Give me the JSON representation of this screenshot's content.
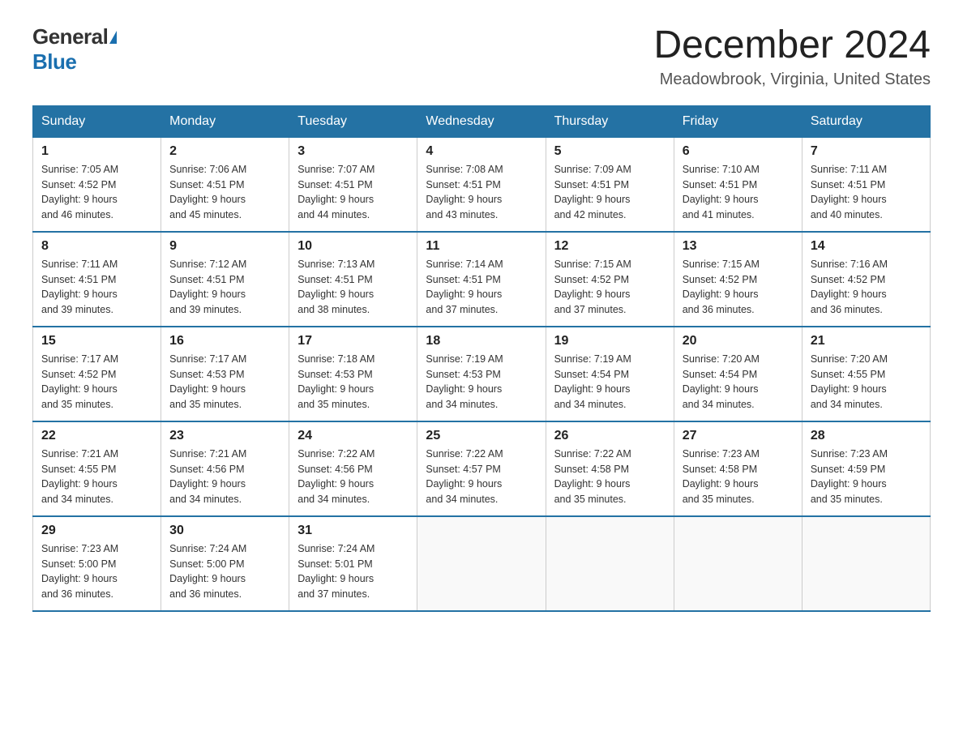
{
  "header": {
    "logo_general": "General",
    "logo_blue": "Blue",
    "title": "December 2024",
    "subtitle": "Meadowbrook, Virginia, United States"
  },
  "days_of_week": [
    "Sunday",
    "Monday",
    "Tuesday",
    "Wednesday",
    "Thursday",
    "Friday",
    "Saturday"
  ],
  "weeks": [
    [
      {
        "day": "1",
        "sunrise": "7:05 AM",
        "sunset": "4:52 PM",
        "daylight": "9 hours and 46 minutes."
      },
      {
        "day": "2",
        "sunrise": "7:06 AM",
        "sunset": "4:51 PM",
        "daylight": "9 hours and 45 minutes."
      },
      {
        "day": "3",
        "sunrise": "7:07 AM",
        "sunset": "4:51 PM",
        "daylight": "9 hours and 44 minutes."
      },
      {
        "day": "4",
        "sunrise": "7:08 AM",
        "sunset": "4:51 PM",
        "daylight": "9 hours and 43 minutes."
      },
      {
        "day": "5",
        "sunrise": "7:09 AM",
        "sunset": "4:51 PM",
        "daylight": "9 hours and 42 minutes."
      },
      {
        "day": "6",
        "sunrise": "7:10 AM",
        "sunset": "4:51 PM",
        "daylight": "9 hours and 41 minutes."
      },
      {
        "day": "7",
        "sunrise": "7:11 AM",
        "sunset": "4:51 PM",
        "daylight": "9 hours and 40 minutes."
      }
    ],
    [
      {
        "day": "8",
        "sunrise": "7:11 AM",
        "sunset": "4:51 PM",
        "daylight": "9 hours and 39 minutes."
      },
      {
        "day": "9",
        "sunrise": "7:12 AM",
        "sunset": "4:51 PM",
        "daylight": "9 hours and 39 minutes."
      },
      {
        "day": "10",
        "sunrise": "7:13 AM",
        "sunset": "4:51 PM",
        "daylight": "9 hours and 38 minutes."
      },
      {
        "day": "11",
        "sunrise": "7:14 AM",
        "sunset": "4:51 PM",
        "daylight": "9 hours and 37 minutes."
      },
      {
        "day": "12",
        "sunrise": "7:15 AM",
        "sunset": "4:52 PM",
        "daylight": "9 hours and 37 minutes."
      },
      {
        "day": "13",
        "sunrise": "7:15 AM",
        "sunset": "4:52 PM",
        "daylight": "9 hours and 36 minutes."
      },
      {
        "day": "14",
        "sunrise": "7:16 AM",
        "sunset": "4:52 PM",
        "daylight": "9 hours and 36 minutes."
      }
    ],
    [
      {
        "day": "15",
        "sunrise": "7:17 AM",
        "sunset": "4:52 PM",
        "daylight": "9 hours and 35 minutes."
      },
      {
        "day": "16",
        "sunrise": "7:17 AM",
        "sunset": "4:53 PM",
        "daylight": "9 hours and 35 minutes."
      },
      {
        "day": "17",
        "sunrise": "7:18 AM",
        "sunset": "4:53 PM",
        "daylight": "9 hours and 35 minutes."
      },
      {
        "day": "18",
        "sunrise": "7:19 AM",
        "sunset": "4:53 PM",
        "daylight": "9 hours and 34 minutes."
      },
      {
        "day": "19",
        "sunrise": "7:19 AM",
        "sunset": "4:54 PM",
        "daylight": "9 hours and 34 minutes."
      },
      {
        "day": "20",
        "sunrise": "7:20 AM",
        "sunset": "4:54 PM",
        "daylight": "9 hours and 34 minutes."
      },
      {
        "day": "21",
        "sunrise": "7:20 AM",
        "sunset": "4:55 PM",
        "daylight": "9 hours and 34 minutes."
      }
    ],
    [
      {
        "day": "22",
        "sunrise": "7:21 AM",
        "sunset": "4:55 PM",
        "daylight": "9 hours and 34 minutes."
      },
      {
        "day": "23",
        "sunrise": "7:21 AM",
        "sunset": "4:56 PM",
        "daylight": "9 hours and 34 minutes."
      },
      {
        "day": "24",
        "sunrise": "7:22 AM",
        "sunset": "4:56 PM",
        "daylight": "9 hours and 34 minutes."
      },
      {
        "day": "25",
        "sunrise": "7:22 AM",
        "sunset": "4:57 PM",
        "daylight": "9 hours and 34 minutes."
      },
      {
        "day": "26",
        "sunrise": "7:22 AM",
        "sunset": "4:58 PM",
        "daylight": "9 hours and 35 minutes."
      },
      {
        "day": "27",
        "sunrise": "7:23 AM",
        "sunset": "4:58 PM",
        "daylight": "9 hours and 35 minutes."
      },
      {
        "day": "28",
        "sunrise": "7:23 AM",
        "sunset": "4:59 PM",
        "daylight": "9 hours and 35 minutes."
      }
    ],
    [
      {
        "day": "29",
        "sunrise": "7:23 AM",
        "sunset": "5:00 PM",
        "daylight": "9 hours and 36 minutes."
      },
      {
        "day": "30",
        "sunrise": "7:24 AM",
        "sunset": "5:00 PM",
        "daylight": "9 hours and 36 minutes."
      },
      {
        "day": "31",
        "sunrise": "7:24 AM",
        "sunset": "5:01 PM",
        "daylight": "9 hours and 37 minutes."
      },
      null,
      null,
      null,
      null
    ]
  ],
  "labels": {
    "sunrise": "Sunrise:",
    "sunset": "Sunset:",
    "daylight": "Daylight:"
  }
}
